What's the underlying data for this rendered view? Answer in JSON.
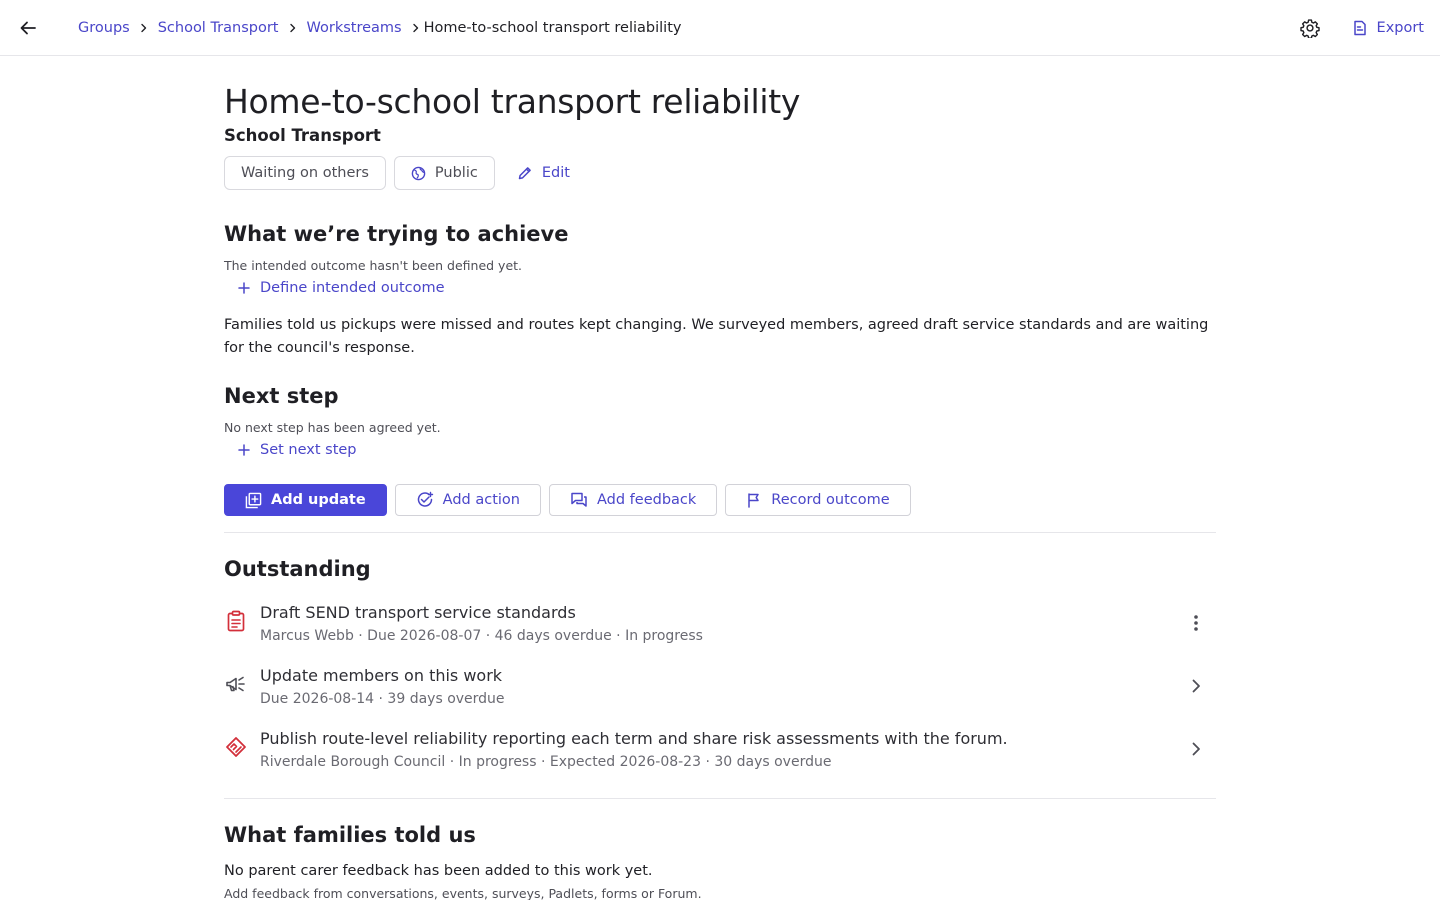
{
  "breadcrumbs": [
    {
      "label": "Groups"
    },
    {
      "label": "School Transport"
    },
    {
      "label": "Workstreams"
    }
  ],
  "breadcrumb_current": "Home-to-school transport reliability",
  "header": {
    "export_label": "Export"
  },
  "page": {
    "title": "Home-to-school transport reliability",
    "subtitle": "School Transport",
    "status_chip": "Waiting on others",
    "visibility_chip": "Public",
    "edit_label": "Edit"
  },
  "achieve": {
    "heading": "What we’re trying to achieve",
    "empty_text": "The intended outcome hasn't been defined yet.",
    "add_label": "Define intended outcome",
    "description": "Families told us pickups were missed and routes kept changing. We surveyed members, agreed draft service standards and are waiting for the council's response."
  },
  "next_step": {
    "heading": "Next step",
    "empty_text": "No next step has been agreed yet.",
    "add_label": "Set next step"
  },
  "actions": {
    "add_update": "Add update",
    "add_action": "Add action",
    "add_feedback": "Add feedback",
    "record_outcome": "Record outcome"
  },
  "outstanding": {
    "heading": "Outstanding",
    "items": [
      {
        "icon": "clipboard-icon",
        "title": "Draft SEND transport service standards",
        "meta": "Marcus Webb · Due 2026-08-07 · 46 days overdue · In progress",
        "action_icon": "more-vertical-icon"
      },
      {
        "icon": "megaphone-icon",
        "title": "Update members on this work",
        "meta": "Due 2026-08-14 · 39 days overdue",
        "action_icon": "chevron-right-icon"
      },
      {
        "icon": "handshake-icon",
        "title": "Publish route-level reliability reporting each term and share risk assessments with the forum.",
        "meta": "Riverdale Borough Council · In progress · Expected 2026-08-23 · 30 days overdue",
        "action_icon": "chevron-right-icon"
      }
    ]
  },
  "feedback": {
    "heading": "What families told us",
    "empty_text": "No parent carer feedback has been added to this work yet.",
    "hint": "Add feedback from conversations, events, surveys, Padlets, forms or Forum."
  },
  "colors": {
    "accent": "#4a46d9",
    "link": "#4a46c9",
    "danger_icon": "#d32f3a",
    "border": "#e6e6ea"
  }
}
